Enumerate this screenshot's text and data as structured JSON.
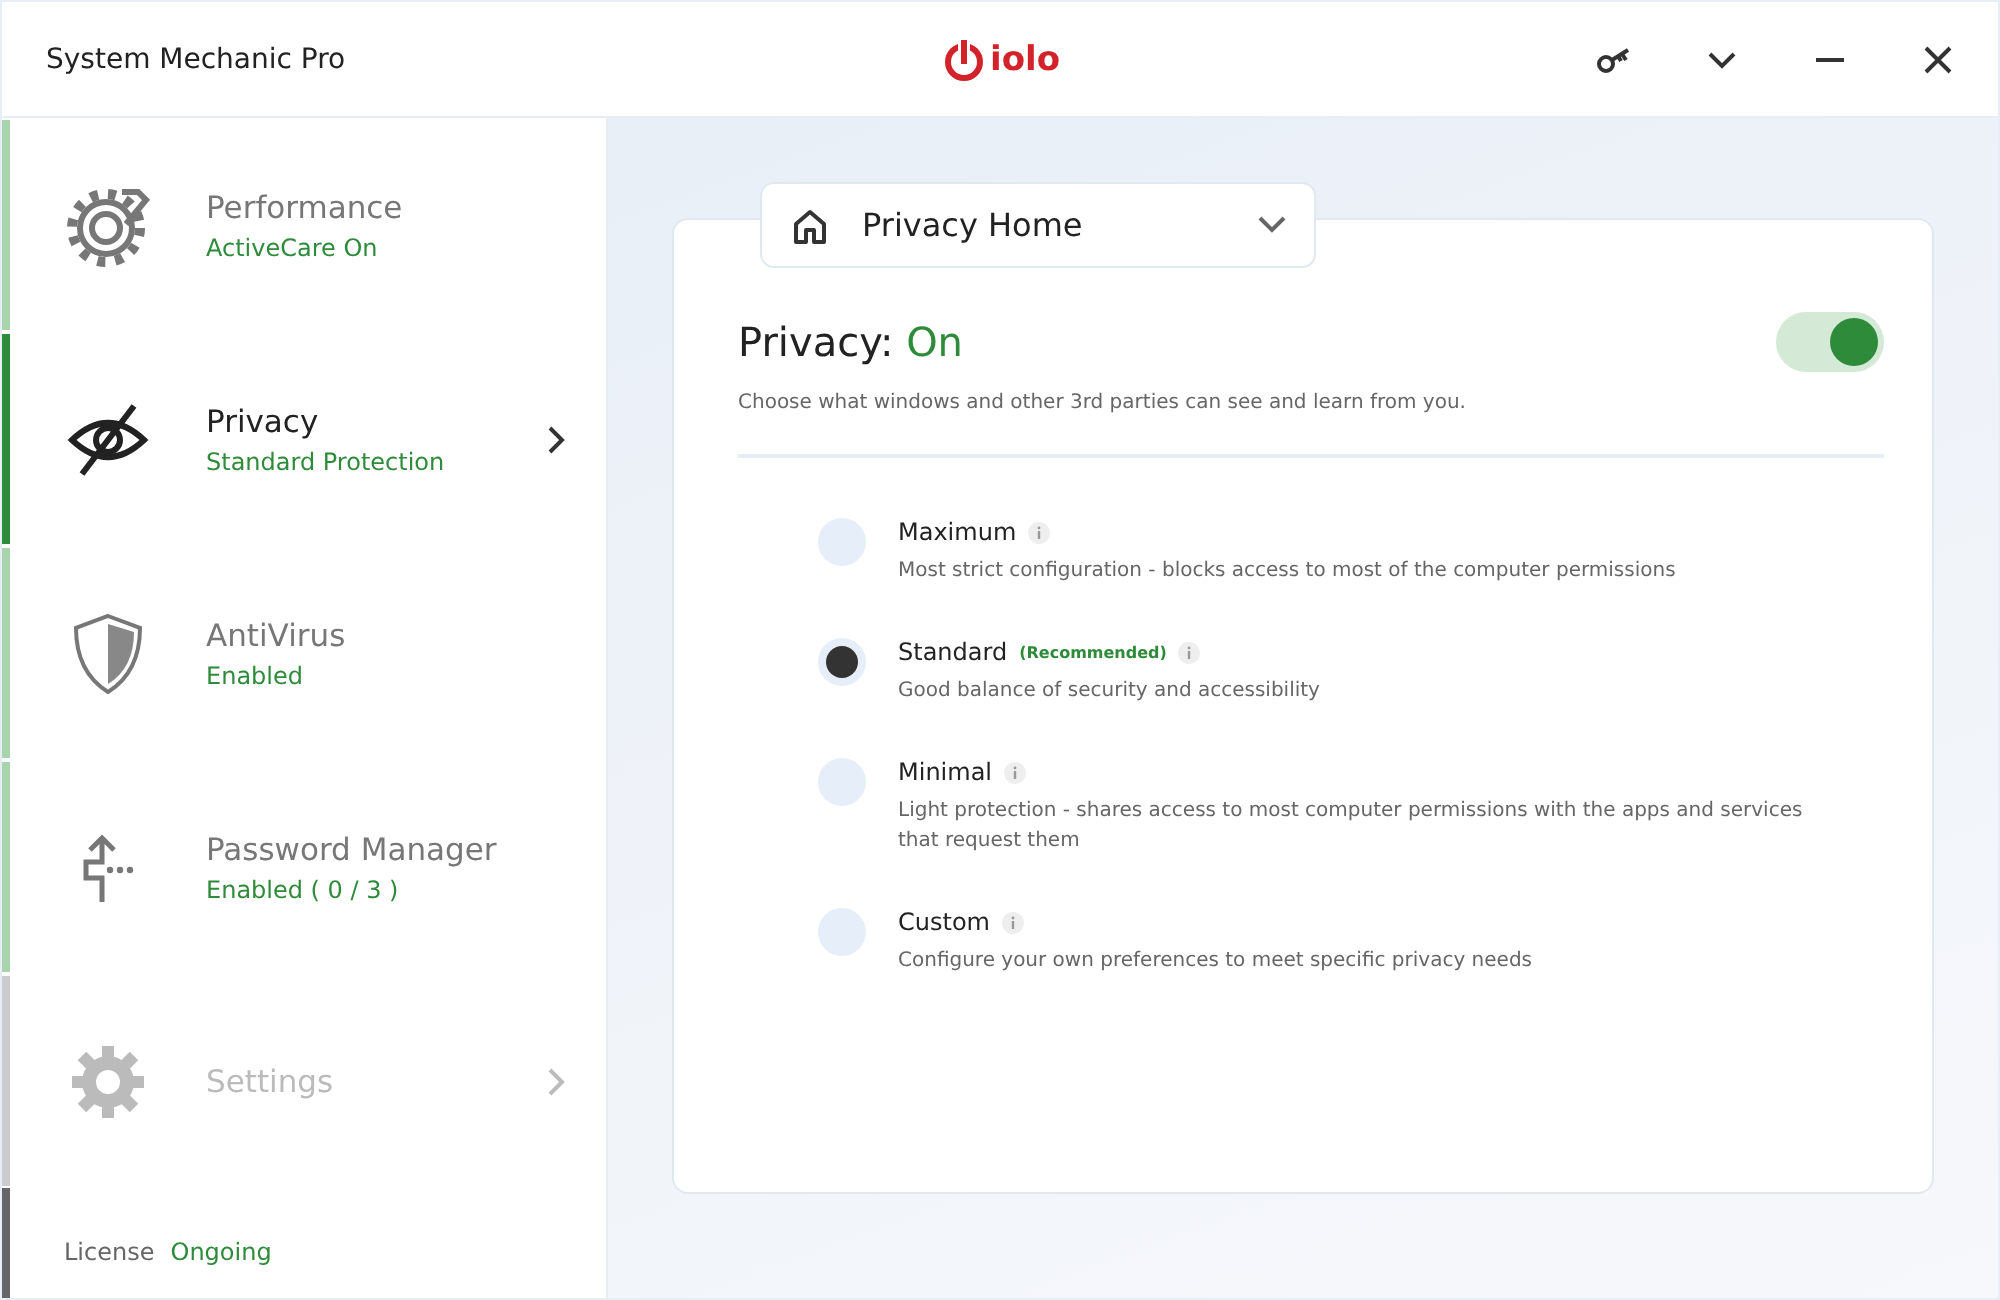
{
  "window": {
    "title": "System Mechanic Pro",
    "logo": "iolo"
  },
  "sidebar": {
    "items": [
      {
        "kind": "performance",
        "label": "Performance",
        "status": "ActiveCare On",
        "selected": false,
        "disabled": false,
        "chevron": false
      },
      {
        "kind": "privacy",
        "label": "Privacy",
        "status": "Standard Protection",
        "selected": true,
        "disabled": false,
        "chevron": true
      },
      {
        "kind": "antivirus",
        "label": "AntiVirus",
        "status": "Enabled",
        "selected": false,
        "disabled": false,
        "chevron": false
      },
      {
        "kind": "password",
        "label": "Password Manager",
        "status": "Enabled ( 0 / 3 )",
        "selected": false,
        "disabled": false,
        "chevron": false
      },
      {
        "kind": "settings",
        "label": "Settings",
        "selected": false,
        "disabled": true,
        "chevron": true
      }
    ],
    "license": {
      "label": "License",
      "value": "Ongoing"
    }
  },
  "dropdown": {
    "value": "Privacy Home"
  },
  "privacy": {
    "label": "Privacy:",
    "state": "On",
    "on": true,
    "description": "Choose what windows and other 3rd parties can see and learn from you.",
    "options": [
      {
        "name": "Maximum",
        "description": "Most strict configuration - blocks access to most of the computer permissions",
        "selected": false
      },
      {
        "name": "Standard",
        "tag": "(Recommended)",
        "description": "Good balance of security and accessibility",
        "selected": true
      },
      {
        "name": "Minimal",
        "description": "Light protection - shares access to most computer permissions with the apps and services that request them",
        "selected": false
      },
      {
        "name": "Custom",
        "description": "Configure your own preferences to meet specific privacy needs",
        "selected": false
      }
    ]
  }
}
